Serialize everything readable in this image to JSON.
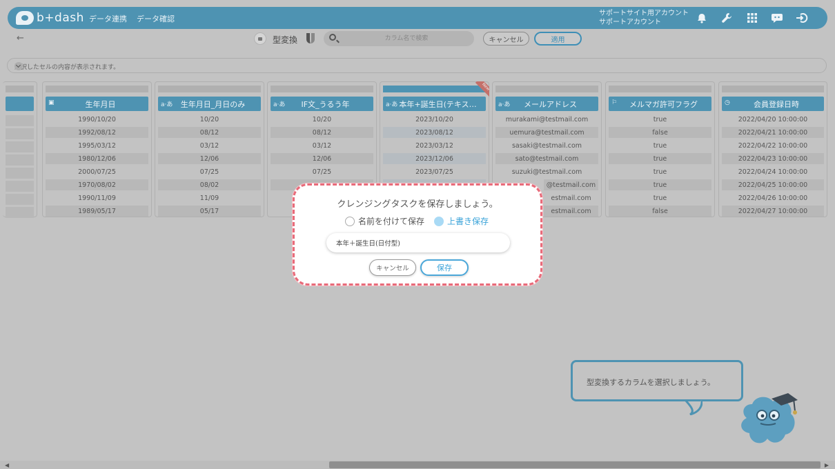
{
  "header": {
    "logo_text": "b+dash",
    "nav": [
      "データ連携",
      "データ確認"
    ],
    "account_line1": "サポートサイト用アカウント",
    "account_line2": "サポートアカウント",
    "icons": [
      "bell-icon",
      "wrench-icon",
      "grid-icon",
      "chat-icon",
      "logout-icon"
    ],
    "accent": "#4e93b2"
  },
  "toolbar": {
    "title": "型変換",
    "search_placeholder": "カラム名で検索",
    "cancel_label": "キャンセル",
    "apply_label": "適用"
  },
  "info": {
    "text": "選択したセルの内容が表示されます。"
  },
  "columns": [
    {
      "header": "",
      "cells": [
        "",
        "",
        "",
        "",
        "",
        "",
        "",
        ""
      ]
    },
    {
      "header": "生年月日",
      "icon": "calendar-icon",
      "cells": [
        "1990/10/20",
        "1992/08/12",
        "1995/03/12",
        "1980/12/06",
        "2000/07/25",
        "1970/08/02",
        "1990/11/09",
        "1989/05/17"
      ]
    },
    {
      "header": "生年月日_月日のみ",
      "icon": "text-type-icon",
      "cells": [
        "10/20",
        "08/12",
        "03/12",
        "12/06",
        "07/25",
        "08/02",
        "11/09",
        "05/17"
      ]
    },
    {
      "header": "IF文_うるう年",
      "icon": "text-type-icon",
      "cells": [
        "10/20",
        "08/12",
        "03/12",
        "12/06",
        "07/25",
        "",
        "",
        ""
      ]
    },
    {
      "header": "本年+誕生日(テキス…",
      "icon": "text-type-icon",
      "cells": [
        "2023/10/20",
        "2023/08/12",
        "2023/03/12",
        "2023/12/06",
        "2023/07/25",
        "",
        "",
        ""
      ]
    },
    {
      "header": "メールアドレス",
      "icon": "text-type-icon",
      "cells": [
        "murakami@testmail.com",
        "uemura@testmail.com",
        "sasaki@testmail.com",
        "sato@testmail.com",
        "suzuki@testmail.com",
        "@testmail.com",
        "estmail.com",
        "estmail.com"
      ]
    },
    {
      "header": "メルマガ許可フラグ",
      "icon": "flag-type-icon",
      "cells": [
        "true",
        "false",
        "true",
        "true",
        "true",
        "true",
        "true",
        "false"
      ]
    },
    {
      "header": "会員登録日時",
      "icon": "clock-icon",
      "cells": [
        "2022/04/20 10:00:00",
        "2022/04/21 10:00:00",
        "2022/04/22 10:00:00",
        "2022/04/23 10:00:00",
        "2022/04/24 10:00:00",
        "2022/04/25 10:00:00",
        "2022/04/26 10:00:00",
        "2022/04/27 10:00:00"
      ]
    }
  ],
  "modal": {
    "title": "クレンジングタスクを保存しましょう。",
    "option_new": "名前を付けて保存",
    "option_overwrite": "上書き保存",
    "selected": "上書き保存",
    "name_value": "本年＋誕生日(日付型)",
    "cancel_label": "キャンセル",
    "save_label": "保存",
    "border_color": "#e86b7a"
  },
  "tooltip": {
    "text": "型変換するカラムを選択しましょう。"
  }
}
